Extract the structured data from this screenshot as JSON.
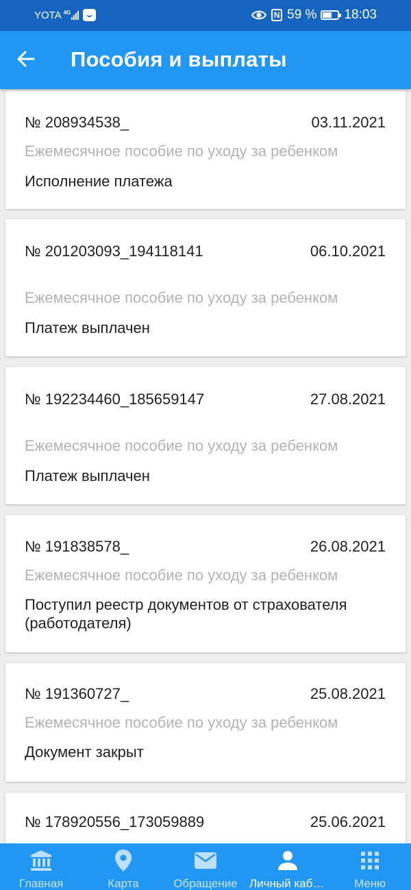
{
  "status_bar": {
    "carrier": "YOTA",
    "network": "4G",
    "battery": "59 %",
    "time": "18:03",
    "icons": [
      "signal-icon",
      "app-notification-icon",
      "eye-icon",
      "nfc-icon",
      "battery-icon"
    ]
  },
  "app_bar": {
    "title": "Пособия и выплаты",
    "back_icon": "arrow-back-icon"
  },
  "payments": [
    {
      "number": "№ 208934538_",
      "date": "03.11.2021",
      "type": "Ежемесячное пособие по уходу за ребенком",
      "status": "Исполнение платежа"
    },
    {
      "number": "№ 201203093_194118141",
      "date": "06.10.2021",
      "type": "Ежемесячное пособие по уходу за ребенком",
      "status": "Платеж выплачен"
    },
    {
      "number": "№ 192234460_185659147",
      "date": "27.08.2021",
      "type": "Ежемесячное пособие по уходу за ребенком",
      "status": "Платеж выплачен"
    },
    {
      "number": "№ 191838578_",
      "date": "26.08.2021",
      "type": "Ежемесячное пособие по уходу за ребенком",
      "status": "Поступил реестр документов от страхователя (работодателя)"
    },
    {
      "number": "№ 191360727_",
      "date": "25.08.2021",
      "type": "Ежемесячное пособие по уходу за ребенком",
      "status": "Документ закрыт"
    },
    {
      "number": "№ 178920556_173059889",
      "date": "25.06.2021",
      "type": "",
      "status": ""
    }
  ],
  "bottom_nav": [
    {
      "label": "Главная",
      "icon": "bank-icon",
      "active": false
    },
    {
      "label": "Карта",
      "icon": "location-pin-icon",
      "active": false
    },
    {
      "label": "Обращение",
      "icon": "mail-icon",
      "active": false
    },
    {
      "label": "Личный кабинет",
      "icon": "person-icon",
      "active": true
    },
    {
      "label": "Меню",
      "icon": "grid-menu-icon",
      "active": false
    }
  ],
  "colors": {
    "status_bar": "#1565c0",
    "app_bar": "#2196f3",
    "bottom_nav": "#2196f3",
    "secondary_text": "#b3b3b3",
    "background": "#eeeeee"
  }
}
